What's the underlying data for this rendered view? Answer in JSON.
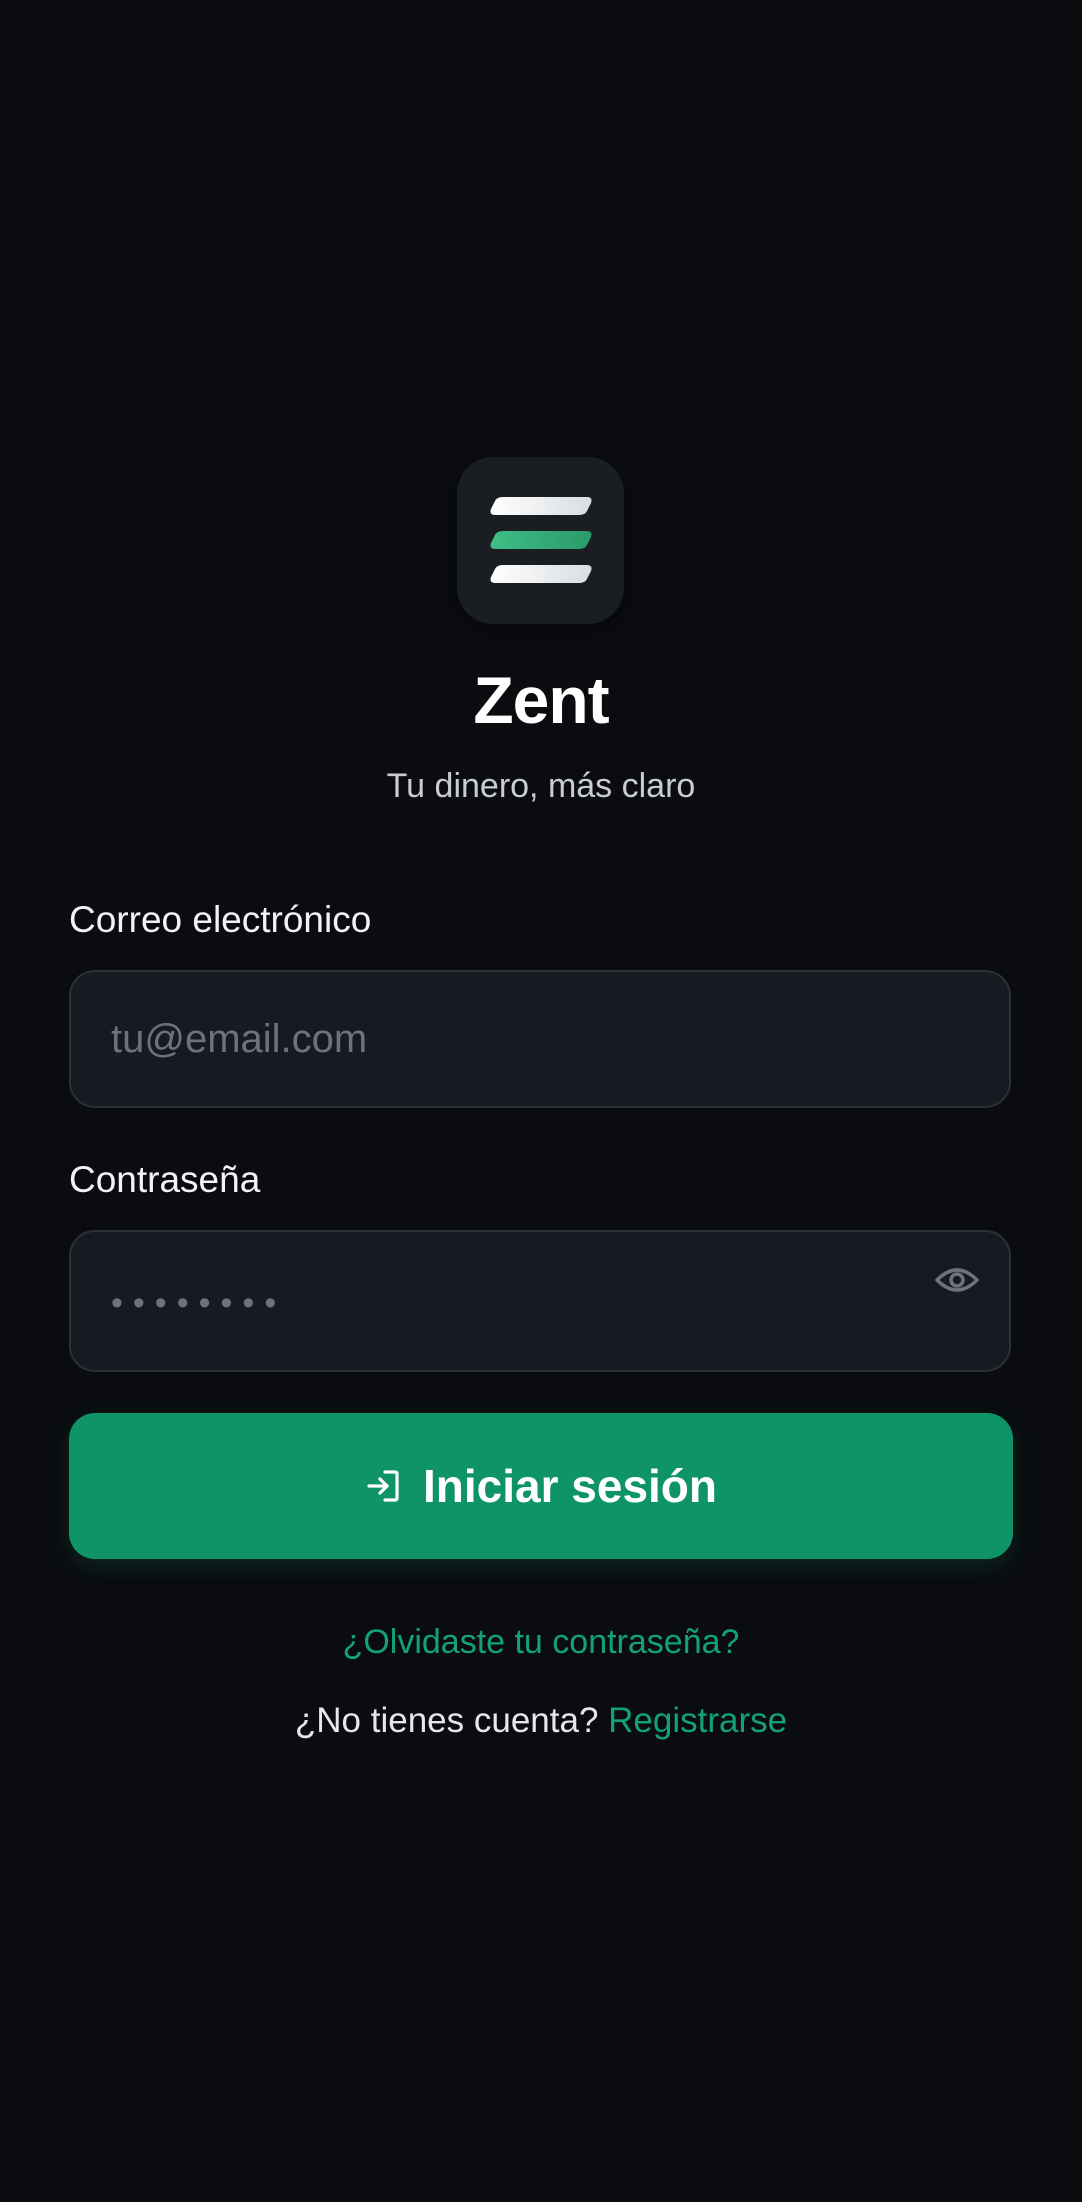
{
  "app": {
    "name": "Zent",
    "tagline": "Tu dinero, más claro",
    "logo_icon": "stacked-bars-logo-icon"
  },
  "form": {
    "email_label": "Correo electrónico",
    "email_placeholder": "tu@email.com",
    "email_value": "",
    "password_label": "Contraseña",
    "password_placeholder": "••••••••",
    "password_value": "",
    "show_password_icon": "eye-icon"
  },
  "actions": {
    "login_label": "Iniciar sesión",
    "login_icon": "login-arrow-icon",
    "forgot_password": "¿Olvidaste tu contraseña?",
    "no_account_text": "¿No tienes cuenta?",
    "register_label": "Registrarse"
  },
  "colors": {
    "background": "#0a0c0f",
    "accent": "#0f9468",
    "link": "#12a276",
    "input_bg": "#171b21"
  }
}
